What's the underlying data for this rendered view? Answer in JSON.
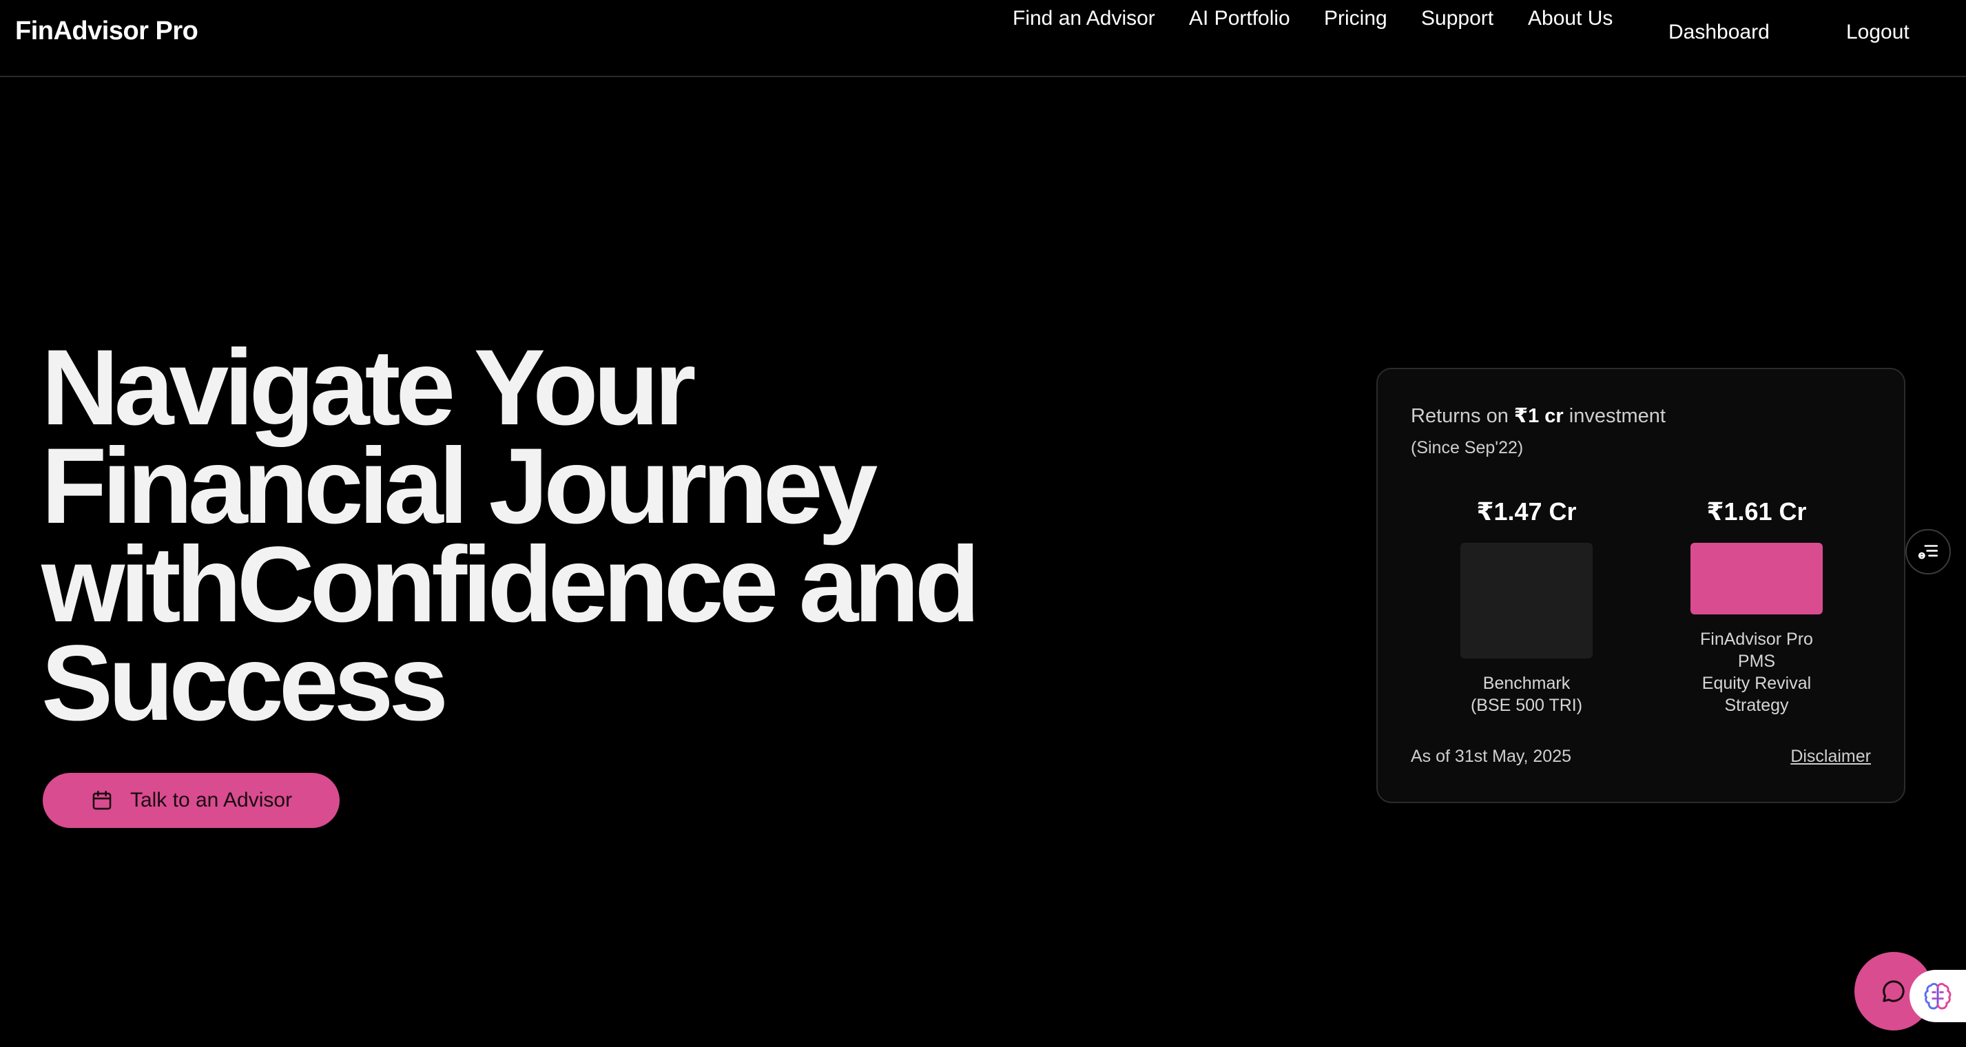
{
  "header": {
    "brand": "FinAdvisor Pro",
    "nav": [
      {
        "label": "Find an Advisor"
      },
      {
        "label": "AI Portfolio"
      },
      {
        "label": "Pricing"
      },
      {
        "label": "Support"
      },
      {
        "label": "About Us"
      }
    ],
    "dashboard_label": "Dashboard",
    "logout_label": "Logout"
  },
  "hero": {
    "title_lines": [
      "Navigate Your",
      "Financial Journey",
      "withConfidence and",
      "Success"
    ],
    "cta_label": "Talk to an Advisor",
    "cta_icon": "calendar-icon"
  },
  "returns_card": {
    "title_prefix": "Returns on ",
    "title_amount": "₹1 cr",
    "title_suffix": " investment",
    "subtitle": "(Since Sep'22)",
    "items": [
      {
        "value": "₹1.47 Cr",
        "label_lines": [
          "Benchmark",
          "(BSE 500 TRI)"
        ],
        "color": "#1d1d1d"
      },
      {
        "value": "₹1.61 Cr",
        "label_lines": [
          "FinAdvisor Pro",
          "PMS",
          "Equity Revival",
          "Strategy"
        ],
        "color": "#d94c8f"
      }
    ],
    "as_of": "As of 31st May, 2025",
    "disclaimer": "Disclaimer"
  },
  "widgets": {
    "side_icon": "list-settings-icon",
    "chat_icon": "chat-bubble-icon",
    "brain_icon": "brain-icon"
  },
  "colors": {
    "background": "#000000",
    "accent": "#d94c8f",
    "card_bg": "#0b0b0b",
    "card_border": "#2b2b2b"
  }
}
